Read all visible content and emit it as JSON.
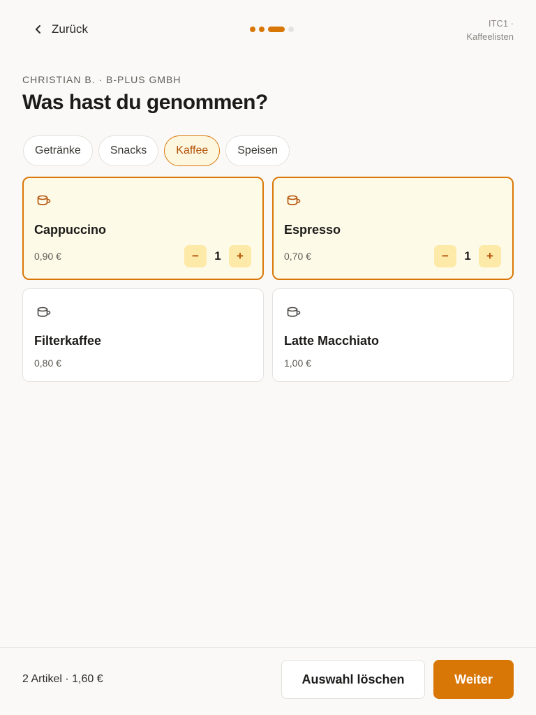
{
  "header": {
    "back_label": "Zurück",
    "corner_line1": "ITC1 ·",
    "corner_line2": "Kaffeelisten",
    "progress": {
      "total_steps": 4,
      "current_step": 3
    }
  },
  "subtitle": "CHRISTIAN B. · B-PLUS GMBH",
  "heading": "Was hast du genommen?",
  "tabs": [
    {
      "label": "Getränke",
      "selected": false
    },
    {
      "label": "Snacks",
      "selected": false
    },
    {
      "label": "Kaffee",
      "selected": true
    },
    {
      "label": "Speisen",
      "selected": false
    }
  ],
  "products": [
    {
      "name": "Cappuccino",
      "price": "0,90 €",
      "selected": true,
      "quantity": "1"
    },
    {
      "name": "Espresso",
      "price": "0,70 €",
      "selected": true,
      "quantity": "1"
    },
    {
      "name": "Filterkaffee",
      "price": "0,80 €",
      "selected": false
    },
    {
      "name": "Latte Macchiato",
      "price": "1,00 €",
      "selected": false
    }
  ],
  "stepper": {
    "minus": "−",
    "plus": "+"
  },
  "footer": {
    "summary": "2 Artikel · 1,60 €",
    "clear_label": "Auswahl löschen",
    "next_label": "Weiter"
  },
  "colors": {
    "accent": "#d97706",
    "selected_card_bg": "#fefae8",
    "stepper_bg": "#fdeaa8"
  },
  "icons": {
    "back": "chevron-left-icon",
    "product": "coffee-cup-icon"
  }
}
